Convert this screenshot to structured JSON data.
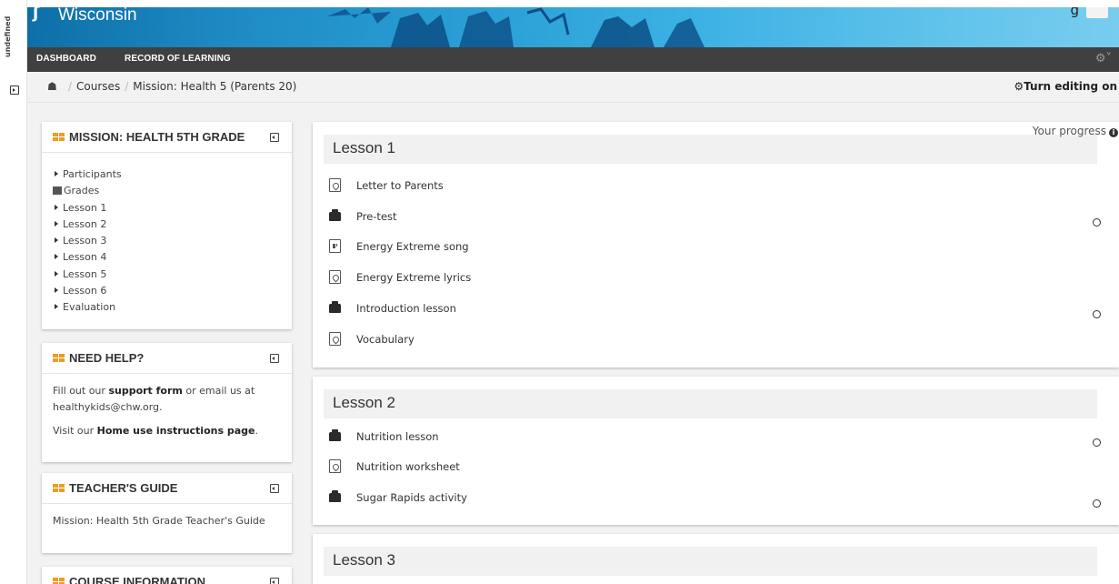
{
  "side_strip": {
    "label": "undefined"
  },
  "banner": {
    "brand": "Wisconsin",
    "edge_text": "g"
  },
  "navbar": {
    "items": [
      "DASHBOARD",
      "RECORD OF LEARNING"
    ]
  },
  "breadcrumb": {
    "items": [
      "Courses",
      "Mission: Health 5 (Parents 20)"
    ],
    "edit_label": "Turn editing on"
  },
  "blocks": {
    "mission": {
      "title": "MISSION: HEALTH 5TH GRADE",
      "items": [
        "Participants",
        "Grades",
        "Lesson 1",
        "Lesson 2",
        "Lesson 3",
        "Lesson 4",
        "Lesson 5",
        "Lesson 6",
        "Evaluation"
      ]
    },
    "help": {
      "title": "NEED HELP?",
      "line1_pre": "Fill out our ",
      "line1_link": "support form",
      "line1_post": " or email us at healthykids@chw.org.",
      "line2_pre": "Visit our ",
      "line2_link": "Home use instructions page",
      "line2_post": "."
    },
    "guide": {
      "title": "TEACHER'S GUIDE",
      "text": "Mission: Health 5th Grade Teacher's Guide"
    },
    "info": {
      "title": "COURSE INFORMATION"
    }
  },
  "progress_label": "Your progress",
  "sections": [
    {
      "title": "Lesson 1",
      "activities": [
        {
          "label": "Letter to Parents",
          "icon": "pdf-icon",
          "completion": false
        },
        {
          "label": "Pre-test",
          "icon": "quiz-icon",
          "completion": true
        },
        {
          "label": "Energy Extreme song",
          "icon": "audio-icon",
          "completion": false
        },
        {
          "label": "Energy Extreme lyrics",
          "icon": "pdf-icon",
          "completion": false
        },
        {
          "label": "Introduction lesson",
          "icon": "quiz-icon",
          "completion": true
        },
        {
          "label": "Vocabulary",
          "icon": "pdf-icon",
          "completion": false
        }
      ]
    },
    {
      "title": "Lesson 2",
      "activities": [
        {
          "label": "Nutrition lesson",
          "icon": "quiz-icon",
          "completion": true
        },
        {
          "label": "Nutrition worksheet",
          "icon": "pdf-icon",
          "completion": false
        },
        {
          "label": "Sugar Rapids activity",
          "icon": "quiz-icon",
          "completion": true
        }
      ]
    },
    {
      "title": "Lesson 3",
      "activities": []
    }
  ],
  "colors": {
    "navbar": "#404040",
    "banner": "#2da2d8",
    "block_icon": "#f39a1f",
    "page_bg": "#f2f2f2"
  }
}
